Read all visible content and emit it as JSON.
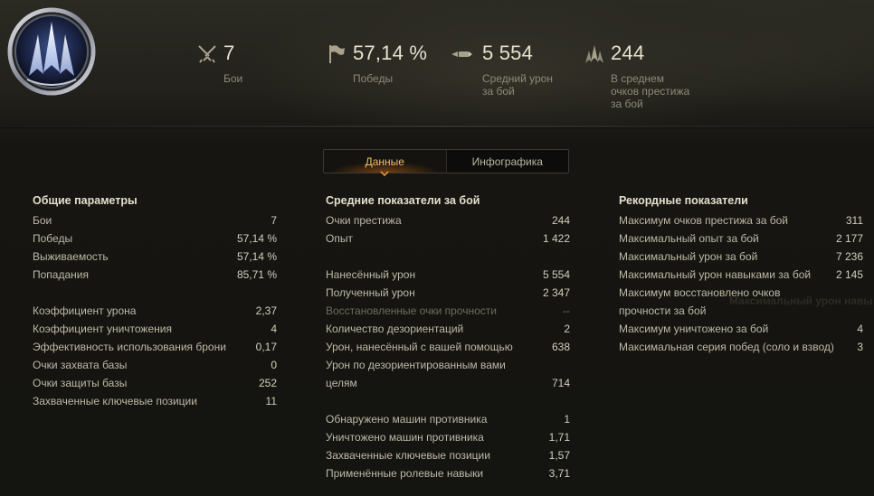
{
  "header": {
    "stats": [
      {
        "icon": "crossed-swords-icon",
        "value": "7",
        "label": "Бои"
      },
      {
        "icon": "victory-flag-icon",
        "value": "57,14 %",
        "label": "Победы"
      },
      {
        "icon": "damage-shell-icon",
        "value": "5 554",
        "label": "Средний урон за бой"
      },
      {
        "icon": "prestige-chevron-icon",
        "value": "244",
        "label": "В среднем очков престижа за бой"
      }
    ]
  },
  "tabs": [
    {
      "label": "Данные",
      "active": true
    },
    {
      "label": "Инфографика",
      "active": false
    }
  ],
  "general": {
    "title": "Общие параметры",
    "rows": [
      {
        "name": "Бои",
        "value": "7"
      },
      {
        "name": "Победы",
        "value": "57,14 %"
      },
      {
        "name": "Выживаемость",
        "value": "57,14 %"
      },
      {
        "name": "Попадания",
        "value": "85,71 %"
      },
      {
        "name": "Коэффициент урона",
        "value": "2,37"
      },
      {
        "name": "Коэффициент уничтожения",
        "value": "4"
      },
      {
        "name": "Эффективность использования брони",
        "value": "0,17"
      },
      {
        "name": "Очки захвата базы",
        "value": "0"
      },
      {
        "name": "Очки защиты базы",
        "value": "252"
      },
      {
        "name": "Захваченные ключевые позиции",
        "value": "11"
      }
    ]
  },
  "average": {
    "title": "Средние показатели за бой",
    "rows": [
      {
        "name": "Очки престижа",
        "value": "244"
      },
      {
        "name": "Опыт",
        "value": "1 422"
      },
      {
        "name": "Нанесённый урон",
        "value": "5 554"
      },
      {
        "name": "Полученный урон",
        "value": "2 347"
      },
      {
        "name": "Восстановленные очки прочности",
        "value": "--"
      },
      {
        "name": "Количество дезориентаций",
        "value": "2"
      },
      {
        "name": "Урон, нанесённый с вашей помощью",
        "value": "638"
      },
      {
        "name": "Урон по дезориентированным вами целям",
        "value": "714"
      },
      {
        "name": "Обнаружено машин противника",
        "value": "1"
      },
      {
        "name": "Уничтожено машин противника",
        "value": "1,71"
      },
      {
        "name": "Захваченные ключевые позиции",
        "value": "1,57"
      },
      {
        "name": "Применённые ролевые навыки",
        "value": "3,71"
      }
    ]
  },
  "records": {
    "title": "Рекордные показатели",
    "rows": [
      {
        "name": "Максимум очков престижа за бой",
        "value": "311"
      },
      {
        "name": "Максимальный опыт за бой",
        "value": "2 177"
      },
      {
        "name": "Максимальный урон за бой",
        "value": "7 236"
      },
      {
        "name": "Максимальный урон навыками за бой",
        "value": "2 145"
      },
      {
        "name": "Максимум восстановлено очков прочности за бой",
        "value": ""
      },
      {
        "name": "Максимум уничтожено за бой",
        "value": "4"
      },
      {
        "name": "Максимальная серия побед (соло и взвод)",
        "value": "3"
      }
    ],
    "ghost_text": "Максимальный урон навы"
  },
  "colors": {
    "accent": "#f2c061",
    "text": "#bdb9a6",
    "heading": "#e4e0cd"
  }
}
